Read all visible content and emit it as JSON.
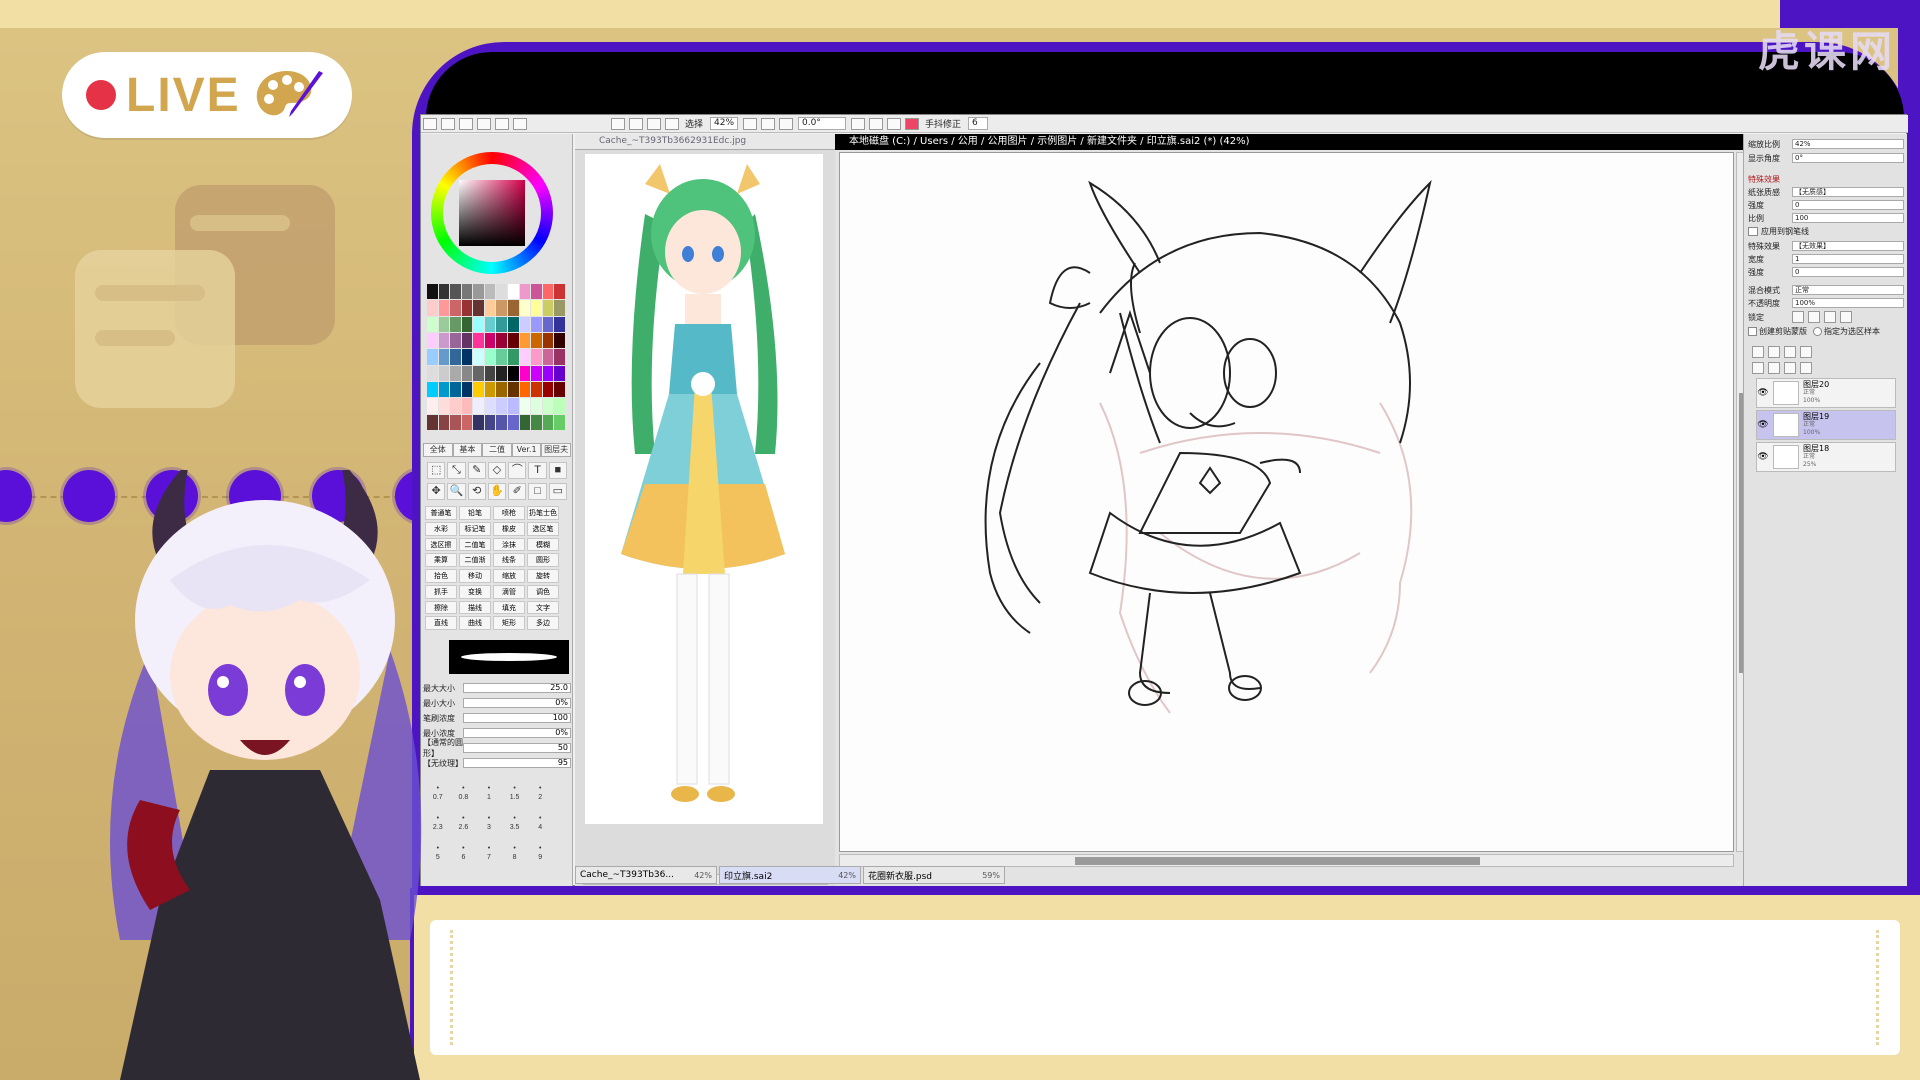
{
  "overlay": {
    "live_label": "LIVE",
    "watermark": "虎课网"
  },
  "toolbar": {
    "selection_label": "选择",
    "zoom_value": "42%",
    "angle_value": "0.0°",
    "stabilizer_label": "手抖修正",
    "stabilizer_value": "6"
  },
  "tool_panel": {
    "tabs": [
      "全体",
      "基本",
      "二值",
      "Ver.1",
      "图层夫"
    ],
    "tool_icons": [
      "⬚",
      "⤡",
      "✎",
      "◇",
      "⌒",
      "T",
      "■",
      "✥",
      "🔍",
      "⟲",
      "✋",
      "✐",
      "□",
      "▭"
    ],
    "brushes": [
      "普通笔",
      "铅笔",
      "喷枪",
      "扔笔士色",
      "水彩",
      "标记笔",
      "橡皮",
      "选区笔",
      "选区擦",
      "二值笔",
      "涂抹",
      "模糊",
      "乘算",
      "二值渐",
      "线条",
      "圆形",
      "拾色",
      "移动",
      "缩放",
      "旋转",
      "抓手",
      "变换",
      "滴管",
      "调色",
      "擦除",
      "描线",
      "填充",
      "文字",
      "直线",
      "曲线",
      "矩形",
      "多边"
    ],
    "params": [
      {
        "label": "最大大小",
        "value": "25.0"
      },
      {
        "label": "最小大小",
        "value": "0%"
      },
      {
        "label": "笔刷浓度",
        "value": "100"
      },
      {
        "label": "最小浓度",
        "value": "0%"
      },
      {
        "label": "【通常的圆形】",
        "value": "50"
      },
      {
        "label": "【无纹理】",
        "value": "95"
      }
    ],
    "sizes": [
      "0.7",
      "0.8",
      "1",
      "1.5",
      "2",
      "2.3",
      "2.6",
      "3",
      "3.5",
      "4",
      "5",
      "6",
      "7",
      "8",
      "9"
    ]
  },
  "reference": {
    "title": "Cache_~T393Tb3662931Edc.jpg"
  },
  "main": {
    "title": "本地磁盘 (C:) / Users / 公用 / 公用图片 / 示例图片 / 新建文件夹 / 印立旗.sai2 (*) (42%)"
  },
  "right_panel": {
    "zoom_label": "缩放比例",
    "zoom_value": "42%",
    "angle_label": "显示角度",
    "angle_value": "0°",
    "section_effects": "特殊效果",
    "paper_label": "纸张质感",
    "paper_value": "【无质感】",
    "strength_label": "强度",
    "strength_value": "0",
    "scale_label": "比例",
    "scale_value": "100",
    "apply_label": "应用到钢笔线",
    "effect_label": "特殊效果",
    "effect_value": "【无效果】",
    "width_label": "宽度",
    "width_value": "1",
    "strength2_label": "强度",
    "strength2_value": "0",
    "blend_label": "混合模式",
    "blend_value": "正常",
    "opacity_label": "不透明度",
    "opacity_value": "100%",
    "lock_label": "锁定",
    "clip_label": "创建剪贴蒙版",
    "selsrc_label": "指定为选区样本",
    "layers": [
      {
        "name": "图层20",
        "mode": "正常",
        "opacity": "100%",
        "selected": false
      },
      {
        "name": "图层19",
        "mode": "正常",
        "opacity": "100%",
        "selected": true
      },
      {
        "name": "图层18",
        "mode": "正常",
        "opacity": "25%",
        "selected": false
      }
    ]
  },
  "doc_tabs": [
    {
      "name": "Cache_~T393Tb36...",
      "zoom": "42%"
    },
    {
      "name": "印立旗.sai2",
      "zoom": "42%"
    },
    {
      "name": "花圈新衣服.psd",
      "zoom": "59%"
    }
  ],
  "colors": {
    "overlay_purple": "#4d14c4",
    "overlay_gold": "#cfb377",
    "live_red": "#e63246",
    "selected_layer": "#c7c3ef"
  }
}
